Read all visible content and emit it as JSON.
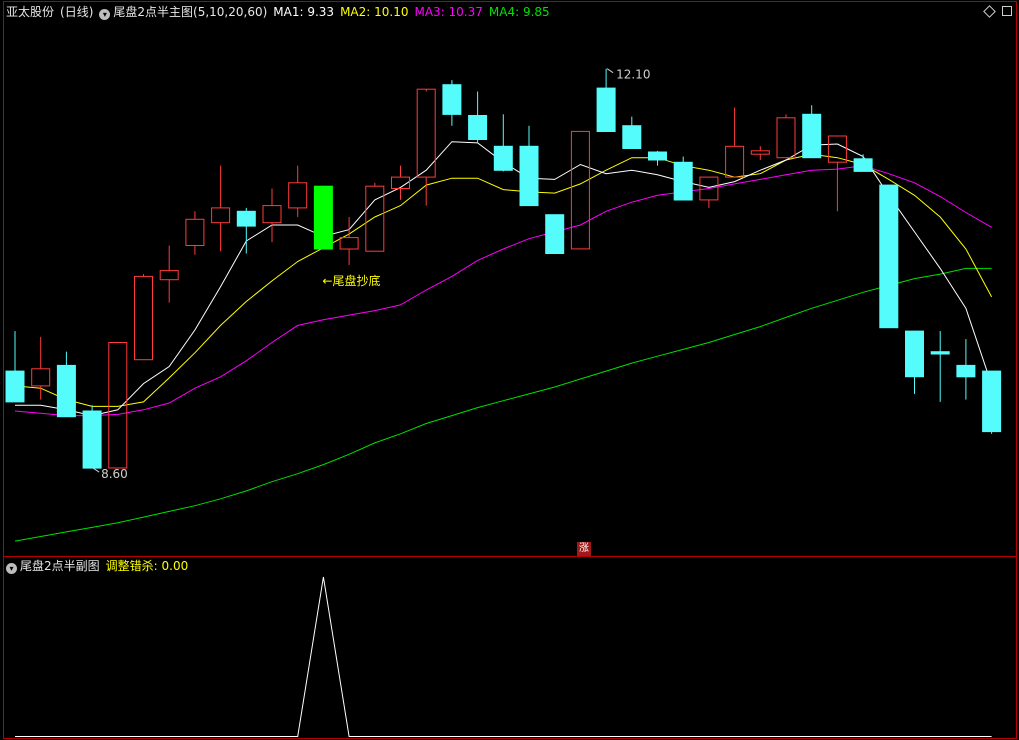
{
  "header": {
    "stock_name": "亚太股份",
    "period": "(日线)",
    "indicator_name": "尾盘2点半主图",
    "params": "(5,10,20,60)",
    "ma1": "MA1: 9.33",
    "ma2": "MA2: 10.10",
    "ma3": "MA3: 10.37",
    "ma4": "MA4: 9.85"
  },
  "sub_header": {
    "indicator_name": "尾盘2点半副图",
    "value_text": "调整错杀: 0.00"
  },
  "badge": {
    "zhang": "涨"
  },
  "colors": {
    "up": "#ff3b3b",
    "down": "#54fcfc",
    "signal": "#00ff00",
    "ma1": "#ffffff",
    "ma2": "#ffff00",
    "ma3": "#ff00ff",
    "ma4": "#00e000",
    "frame": "#b40000"
  },
  "chart_data": {
    "type": "candlestick",
    "price_range": [
      8.0,
      12.5
    ],
    "candles": [
      {
        "o": 9.45,
        "h": 9.8,
        "l": 9.2,
        "c": 9.18
      },
      {
        "o": 9.32,
        "h": 9.75,
        "l": 9.2,
        "c": 9.47
      },
      {
        "o": 9.5,
        "h": 9.62,
        "l": 9.05,
        "c": 9.05
      },
      {
        "o": 9.1,
        "h": 9.15,
        "l": 8.6,
        "c": 8.6
      },
      {
        "o": 8.6,
        "h": 9.7,
        "l": 8.6,
        "c": 9.7
      },
      {
        "o": 9.55,
        "h": 10.3,
        "l": 9.55,
        "c": 10.28
      },
      {
        "o": 10.25,
        "h": 10.55,
        "l": 10.05,
        "c": 10.33
      },
      {
        "o": 10.55,
        "h": 10.85,
        "l": 10.47,
        "c": 10.78
      },
      {
        "o": 10.75,
        "h": 11.25,
        "l": 10.5,
        "c": 10.88
      },
      {
        "o": 10.85,
        "h": 10.88,
        "l": 10.48,
        "c": 10.72
      },
      {
        "o": 10.75,
        "h": 11.05,
        "l": 10.58,
        "c": 10.9
      },
      {
        "o": 10.88,
        "h": 11.25,
        "l": 10.8,
        "c": 11.1
      },
      {
        "o": 11.07,
        "h": 11.07,
        "l": 10.52,
        "c": 10.52
      },
      {
        "o": 10.52,
        "h": 10.8,
        "l": 10.38,
        "c": 10.62
      },
      {
        "o": 10.5,
        "h": 11.1,
        "l": 10.5,
        "c": 11.07
      },
      {
        "o": 11.05,
        "h": 11.25,
        "l": 10.95,
        "c": 11.15
      },
      {
        "o": 11.15,
        "h": 11.9,
        "l": 10.9,
        "c": 11.92
      },
      {
        "o": 11.96,
        "h": 12.0,
        "l": 11.6,
        "c": 11.7
      },
      {
        "o": 11.69,
        "h": 11.9,
        "l": 11.45,
        "c": 11.48
      },
      {
        "o": 11.42,
        "h": 11.7,
        "l": 11.2,
        "c": 11.21
      },
      {
        "o": 11.42,
        "h": 11.6,
        "l": 10.9,
        "c": 10.9
      },
      {
        "o": 10.82,
        "h": 10.82,
        "l": 10.48,
        "c": 10.48
      },
      {
        "o": 10.52,
        "h": 11.55,
        "l": 10.52,
        "c": 11.55
      },
      {
        "o": 11.93,
        "h": 12.1,
        "l": 11.55,
        "c": 11.55
      },
      {
        "o": 11.6,
        "h": 11.68,
        "l": 11.4,
        "c": 11.4
      },
      {
        "o": 11.37,
        "h": 11.38,
        "l": 11.25,
        "c": 11.3
      },
      {
        "o": 11.28,
        "h": 11.33,
        "l": 10.95,
        "c": 10.95
      },
      {
        "o": 10.95,
        "h": 11.15,
        "l": 10.88,
        "c": 11.15
      },
      {
        "o": 11.15,
        "h": 11.76,
        "l": 11.15,
        "c": 11.42
      },
      {
        "o": 11.35,
        "h": 11.42,
        "l": 11.3,
        "c": 11.38
      },
      {
        "o": 11.32,
        "h": 11.7,
        "l": 11.32,
        "c": 11.67
      },
      {
        "o": 11.7,
        "h": 11.78,
        "l": 11.32,
        "c": 11.32
      },
      {
        "o": 11.28,
        "h": 11.51,
        "l": 10.85,
        "c": 11.51
      },
      {
        "o": 11.31,
        "h": 11.35,
        "l": 11.2,
        "c": 11.2
      },
      {
        "o": 11.08,
        "h": 11.08,
        "l": 9.83,
        "c": 9.83
      },
      {
        "o": 9.8,
        "h": 9.8,
        "l": 9.25,
        "c": 9.4
      },
      {
        "o": 9.62,
        "h": 9.8,
        "l": 9.18,
        "c": 9.6
      },
      {
        "o": 9.5,
        "h": 9.73,
        "l": 9.2,
        "c": 9.4
      },
      {
        "o": 9.45,
        "h": 9.45,
        "l": 8.9,
        "c": 8.92
      }
    ],
    "signal_index": 12,
    "ma": {
      "MA1": [
        9.15,
        9.15,
        9.11,
        9.06,
        9.11,
        9.34,
        9.49,
        9.81,
        10.19,
        10.59,
        10.73,
        10.73,
        10.63,
        10.69,
        10.95,
        11.06,
        11.21,
        11.46,
        11.45,
        11.28,
        11.14,
        11.13,
        11.26,
        11.18,
        11.21,
        11.17,
        11.11,
        11.06,
        11.11,
        11.21,
        11.3,
        11.43,
        11.44,
        11.33,
        10.99,
        10.67,
        10.35,
        10.0,
        9.33
      ],
      "MA2": [
        9.32,
        9.3,
        9.2,
        9.14,
        9.14,
        9.18,
        9.39,
        9.61,
        9.85,
        10.06,
        10.24,
        10.41,
        10.53,
        10.65,
        10.8,
        10.9,
        11.08,
        11.14,
        11.14,
        11.04,
        11.02,
        11.01,
        11.09,
        11.21,
        11.32,
        11.32,
        11.25,
        11.21,
        11.15,
        11.18,
        11.3,
        11.35,
        11.32,
        11.26,
        11.13,
        10.99,
        10.8,
        10.52,
        10.1
      ],
      "MA3": [
        9.1,
        9.08,
        9.06,
        9.06,
        9.07,
        9.11,
        9.17,
        9.3,
        9.4,
        9.54,
        9.7,
        9.85,
        9.9,
        9.94,
        9.98,
        10.03,
        10.16,
        10.28,
        10.42,
        10.52,
        10.61,
        10.67,
        10.73,
        10.85,
        10.93,
        10.99,
        11.02,
        11.05,
        11.09,
        11.13,
        11.17,
        11.21,
        11.22,
        11.25,
        11.18,
        11.1,
        10.98,
        10.84,
        10.71
      ],
      "MA4": [
        7.96,
        8.0,
        8.04,
        8.08,
        8.12,
        8.17,
        8.22,
        8.27,
        8.33,
        8.4,
        8.48,
        8.55,
        8.63,
        8.72,
        8.82,
        8.9,
        8.99,
        9.06,
        9.13,
        9.19,
        9.25,
        9.31,
        9.38,
        9.45,
        9.52,
        9.58,
        9.64,
        9.7,
        9.77,
        9.84,
        9.92,
        10.0,
        10.07,
        10.14,
        10.2,
        10.26,
        10.3,
        10.35,
        10.35
      ]
    },
    "sub_values": [
      0,
      0,
      0,
      0,
      0,
      0,
      0,
      0,
      0,
      0,
      0,
      0,
      1,
      0,
      0,
      0,
      0,
      0,
      0,
      0,
      0,
      0,
      0,
      0,
      0,
      0,
      0,
      0,
      0,
      0,
      0,
      0,
      0,
      0,
      0,
      0,
      0,
      0,
      0
    ],
    "annotations": {
      "high_label": "12.10",
      "low_label": "8.60",
      "signal_label": "←尾盘抄底"
    }
  }
}
